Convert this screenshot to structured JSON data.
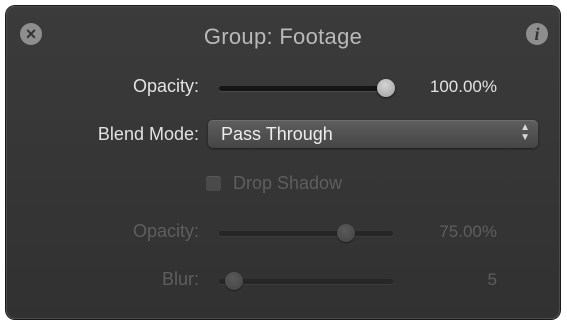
{
  "hud": {
    "title": "Group: Footage",
    "close_icon": "close-icon",
    "info_icon": "info-icon"
  },
  "opacity": {
    "label": "Opacity:",
    "value_text": "100.00%",
    "level": 1.0
  },
  "blend_mode": {
    "label": "Blend Mode:",
    "selected": "Pass Through"
  },
  "drop_shadow": {
    "label": "Drop Shadow",
    "checked": false,
    "enabled": false,
    "opacity": {
      "label": "Opacity:",
      "value_text": "75.00%",
      "level": 0.75
    },
    "blur": {
      "label": "Blur:",
      "value_text": "5",
      "level": 0.05
    }
  },
  "colors": {
    "panel": "#353535",
    "text": "#e2e2e2",
    "disabled_text": "#5e5e5e"
  }
}
